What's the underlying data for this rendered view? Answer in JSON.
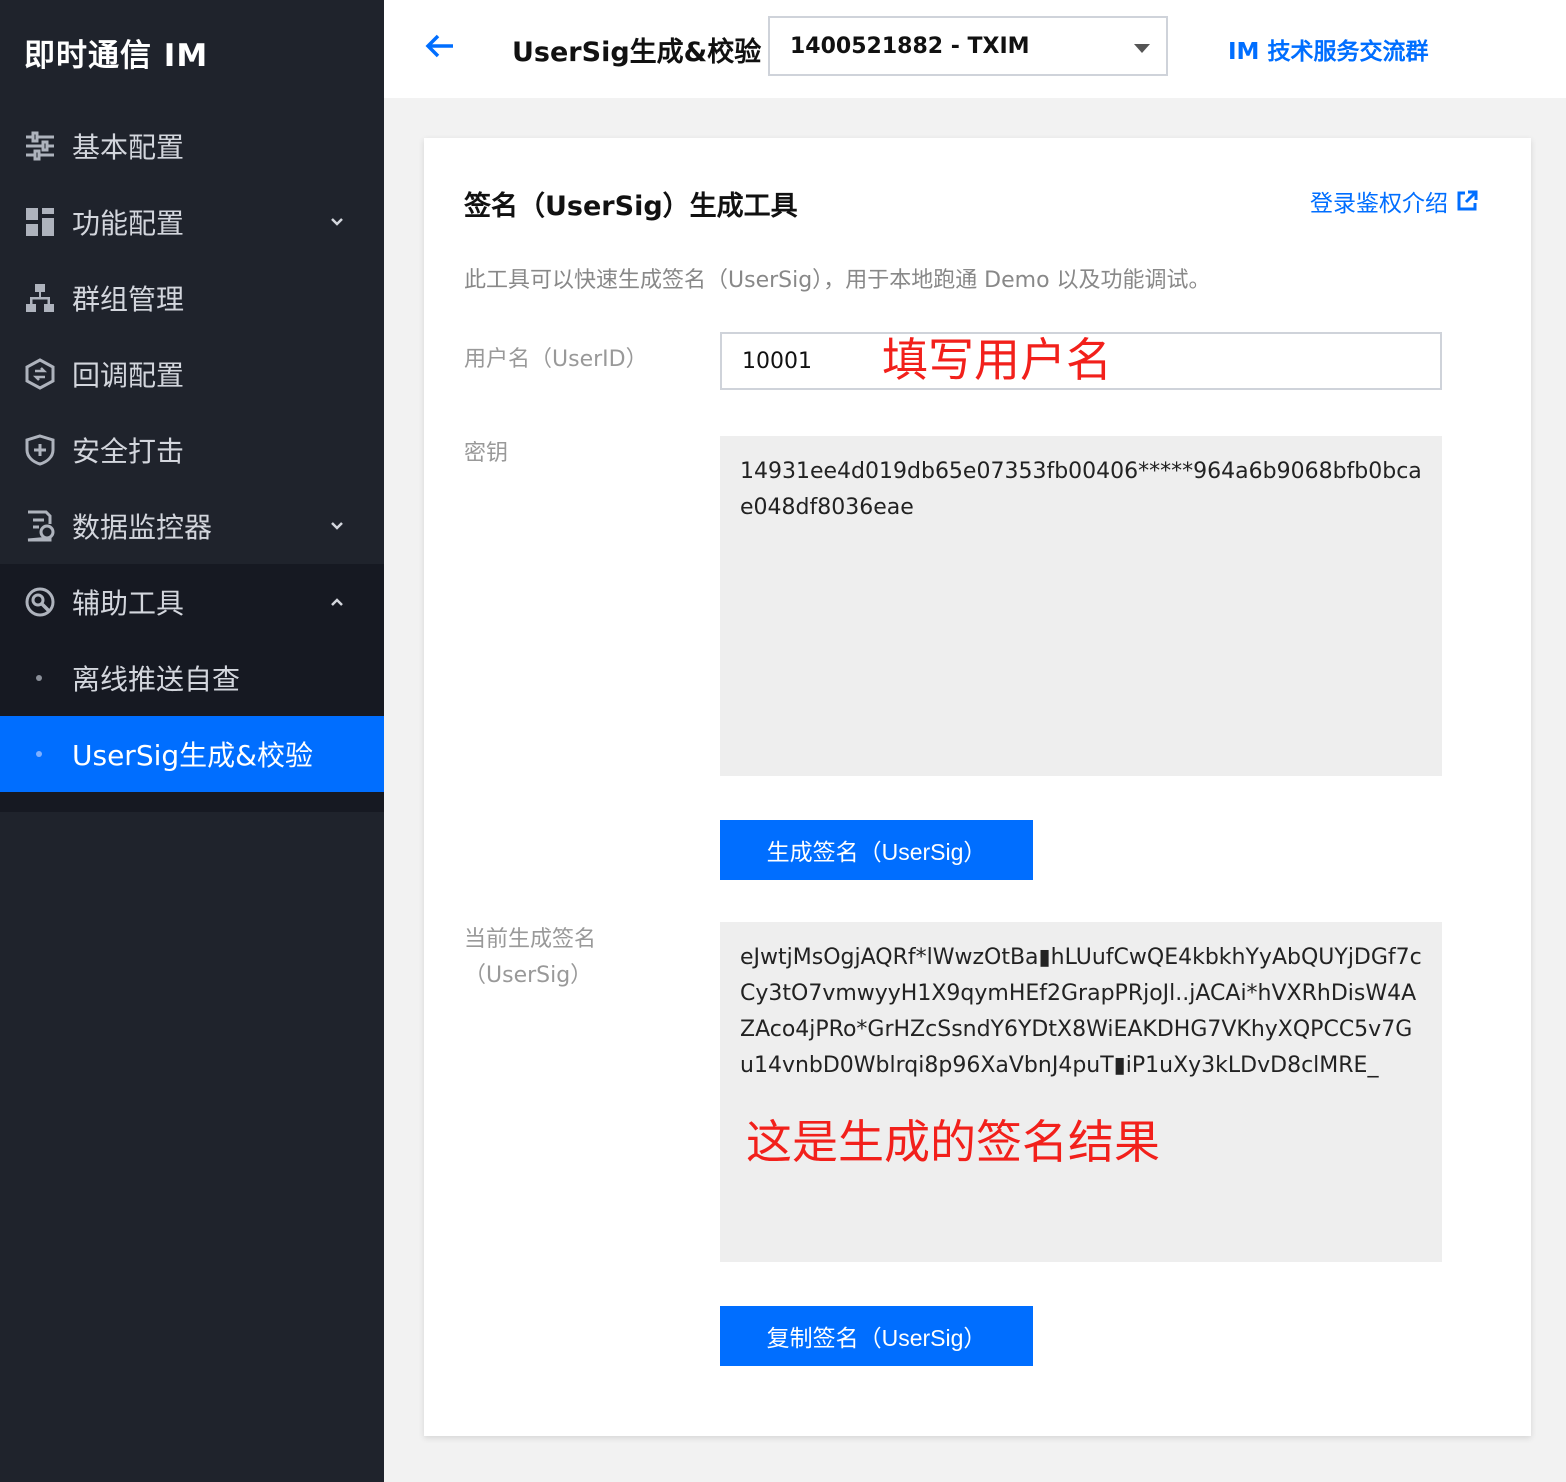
{
  "sidebar": {
    "brand": "即时通信 IM",
    "items": [
      {
        "label": "基本配置",
        "icon": "sliders-icon"
      },
      {
        "label": "功能配置",
        "icon": "grid-icon"
      },
      {
        "label": "群组管理",
        "icon": "org-chart-icon"
      },
      {
        "label": "回调配置",
        "icon": "callback-icon"
      },
      {
        "label": "安全打击",
        "icon": "shield-icon"
      },
      {
        "label": "数据监控器",
        "icon": "monitor-doc-icon"
      },
      {
        "label": "辅助工具",
        "icon": "tools-icon"
      }
    ],
    "sub_items": [
      {
        "label": "离线推送自查"
      },
      {
        "label": "UserSig生成&校验"
      }
    ],
    "active_color": "#006eff"
  },
  "header": {
    "title": "UserSig生成&校验",
    "app_select": "1400521882 - TXIM",
    "group_link": "IM 技术服务交流群"
  },
  "card": {
    "title": "签名（UserSig）生成工具",
    "auth_link": "登录鉴权介绍",
    "description": "此工具可以快速生成签名（UserSig），用于本地跑通 Demo 以及功能调试。",
    "userid_label": "用户名（UserID）",
    "userid_value": "10001",
    "userid_annotation": "填写用户名",
    "key_label": "密钥",
    "key_value": "14931ee4d019db65e07353fb00406*****964a6b9068bfb0bcae048df8036eae",
    "generate_button": "生成签名（UserSig）",
    "sig_label_line1": "当前生成签名",
    "sig_label_line2": "（UserSig）",
    "sig_value": "eJwtjMsOgjAQRf*lWwzOtBa▮hLUufCwQE4kbkhYyAbQUYjDGf7cCy3tO7vmwyyH1X9qymHEf2GrapPRjoJl..jACAi*hVXRhDisW4AZAco4jPRo*GrHZcSsndY6YDtX8WiEAKDHG7VKhyXQPCC5v7Gu14vnbD0Wblrqi8p96XaVbnJ4puT▮iP1uXy3kLDvD8clMRE_",
    "sig_annotation": "这是生成的签名结果",
    "copy_button": "复制签名（UserSig）"
  }
}
